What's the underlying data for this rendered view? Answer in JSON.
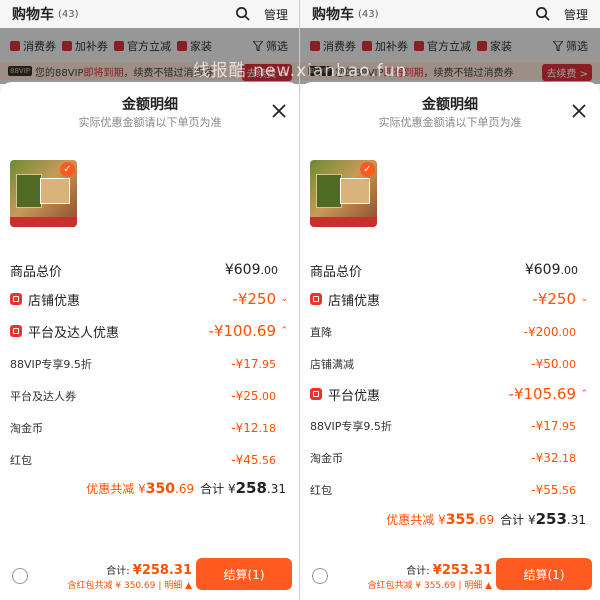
{
  "watermark": "线报酷 new.xianbao.fun",
  "screens": [
    {
      "header": {
        "title": "购物车",
        "count": "(43)",
        "manage": "管理"
      },
      "filters": [
        "消费券",
        "加补券",
        "官方立减",
        "家装"
      ],
      "filter_label": "筛选",
      "vip": {
        "tag": "88VIP",
        "text": "您的88VIP",
        "warn": "即将到期",
        "rest": "，续费不错过消费券",
        "renew": "去续费 >"
      },
      "sheet": {
        "title": "金额明细",
        "subtitle": "实际优惠金额请以下单页为准"
      },
      "rows": [
        {
          "label": "商品总价",
          "value": "¥609",
          "dec": ".00"
        },
        {
          "label": "店铺优惠",
          "value": "-¥250",
          "dec": ""
        },
        {
          "label": "平台及达人优惠",
          "value": "-¥100.69",
          "dec": ""
        },
        {
          "label": "88VIP专享9.5折",
          "value": "-¥17",
          "dec": ".95"
        },
        {
          "label": "平台及达人券",
          "value": "-¥25",
          "dec": ".00"
        },
        {
          "label": "淘金币",
          "value": "-¥12",
          "dec": ".18"
        },
        {
          "label": "红包",
          "value": "-¥45",
          "dec": ".56"
        }
      ],
      "summary": {
        "disc_label": "优惠共减",
        "disc_sym": "¥",
        "disc_int": "350",
        "disc_dec": ".69",
        "tot_label": "合计",
        "tot_sym": "¥",
        "tot_int": "258",
        "tot_dec": ".31"
      },
      "footer": {
        "total_label": "合计:",
        "total_amount": "¥258.31",
        "sub": "含红包共减 ¥ 350.69 | 明细 ▲",
        "checkout": "结算(1)"
      }
    },
    {
      "header": {
        "title": "购物车",
        "count": "(43)",
        "manage": "管理"
      },
      "filters": [
        "消费券",
        "加补券",
        "官方立减",
        "家装"
      ],
      "filter_label": "筛选",
      "vip": {
        "tag": "88VIP",
        "text": "您的88VIP",
        "warn": "即将到期",
        "rest": "，续费不错过消费券",
        "renew": "去续费 >"
      },
      "sheet": {
        "title": "金额明细",
        "subtitle": "实际优惠金额请以下单页为准"
      },
      "rows": [
        {
          "label": "商品总价",
          "value": "¥609",
          "dec": ".00"
        },
        {
          "label": "店铺优惠",
          "value": "-¥250",
          "dec": ""
        },
        {
          "label": "直降",
          "value": "-¥200",
          "dec": ".00"
        },
        {
          "label": "店铺满减",
          "value": "-¥50",
          "dec": ".00"
        },
        {
          "label": "平台优惠",
          "value": "-¥105.69",
          "dec": ""
        },
        {
          "label": "88VIP专享9.5折",
          "value": "-¥17",
          "dec": ".95"
        },
        {
          "label": "淘金币",
          "value": "-¥32",
          "dec": ".18"
        },
        {
          "label": "红包",
          "value": "-¥55",
          "dec": ".56"
        }
      ],
      "summary": {
        "disc_label": "优惠共减",
        "disc_sym": "¥",
        "disc_int": "355",
        "disc_dec": ".69",
        "tot_label": "合计",
        "tot_sym": "¥",
        "tot_int": "253",
        "tot_dec": ".31"
      },
      "footer": {
        "total_label": "合计:",
        "total_amount": "¥253.31",
        "sub": "含红包共减 ¥ 355.69 | 明细 ▲",
        "checkout": "结算(1)"
      }
    }
  ]
}
